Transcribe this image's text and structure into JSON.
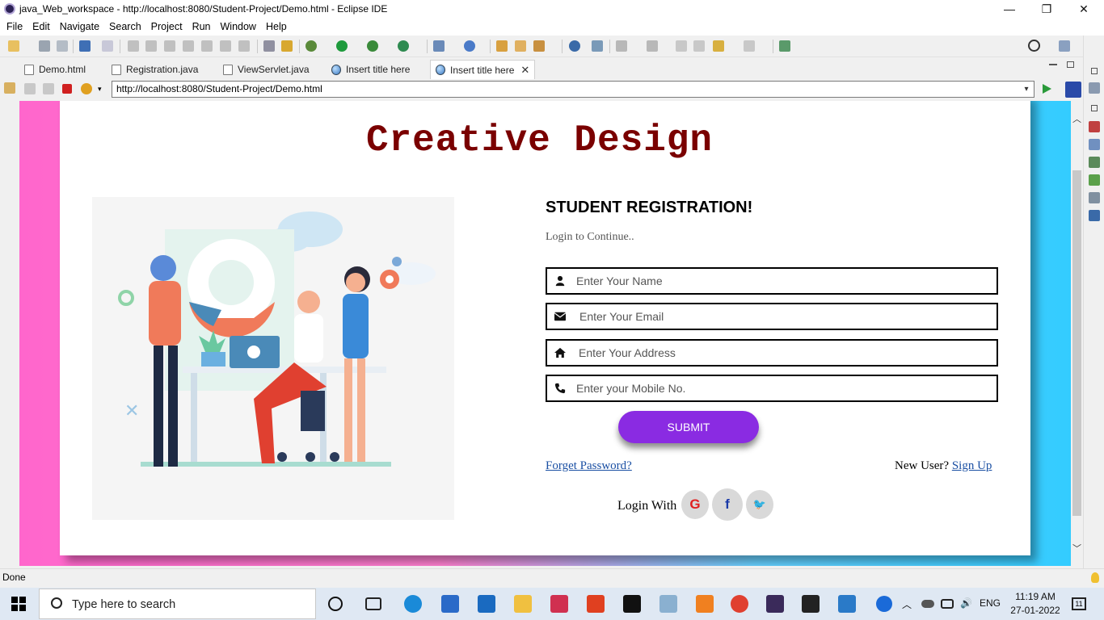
{
  "window": {
    "title": "java_Web_workspace - http://localhost:8080/Student-Project/Demo.html - Eclipse IDE",
    "minimize": "—",
    "restore": "❐",
    "close": "✕"
  },
  "menu": [
    "File",
    "Edit",
    "Navigate",
    "Search",
    "Project",
    "Run",
    "Window",
    "Help"
  ],
  "tabs": [
    {
      "label": "Demo.html",
      "icon": "html-file-icon"
    },
    {
      "label": "Registration.java",
      "icon": "java-file-icon"
    },
    {
      "label": "ViewServlet.java",
      "icon": "java-file-icon"
    },
    {
      "label": "Insert title here",
      "icon": "globe-icon"
    },
    {
      "label": "Insert title here",
      "icon": "globe-icon",
      "active": true,
      "close": "✕"
    }
  ],
  "browser": {
    "url": "http://localhost:8080/Student-Project/Demo.html",
    "url_dropdown": "▾"
  },
  "page": {
    "brand": "Creative Design",
    "form_title": "STUDENT REGISTRATION!",
    "subtitle": "Login to Continue..",
    "fields": {
      "name_placeholder": "Enter Your Name",
      "email_placeholder": "Enter Your Email",
      "address_placeholder": "Enter Your Address",
      "mobile_placeholder": "Enter your Mobile No."
    },
    "submit_label": "SUBMIT",
    "forget_password": "Forget Password?",
    "new_user": "New User?",
    "sign_up": "Sign Up",
    "login_with": "Login With",
    "social": {
      "google": "G",
      "facebook": "f",
      "twitter": "🐦"
    }
  },
  "status": {
    "text": "Done"
  },
  "taskbar": {
    "search_placeholder": "Type here to search",
    "language": "ENG",
    "time": "11:19 AM",
    "date": "27-01-2022",
    "notifications": "11"
  },
  "colors": {
    "brand": "#7a0000",
    "submit": "#8a2be2",
    "link": "#1a4fa3",
    "bg_left": "#ff66cc",
    "bg_right": "#33ccff"
  }
}
